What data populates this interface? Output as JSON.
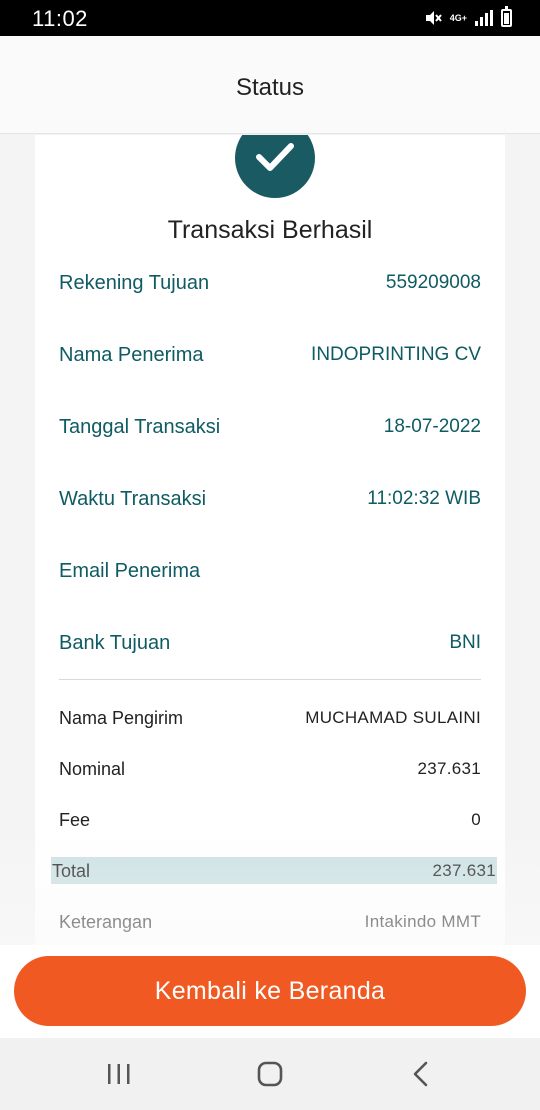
{
  "status_bar": {
    "time": "11:02",
    "network": "4G+",
    "icons": [
      "mute-icon",
      "network-4g-icon",
      "signal-icon",
      "battery-icon"
    ]
  },
  "header": {
    "title": "Status"
  },
  "result": {
    "icon": "check-icon",
    "title": "Transaksi Berhasil"
  },
  "details": [
    {
      "label": "Rekening Tujuan",
      "value": "559209008"
    },
    {
      "label": "Nama Penerima",
      "value": "INDOPRINTING CV"
    },
    {
      "label": "Tanggal Transaksi",
      "value": "18-07-2022"
    },
    {
      "label": "Waktu Transaksi",
      "value": "11:02:32 WIB"
    },
    {
      "label": "Email Penerima",
      "value": ""
    },
    {
      "label": "Bank Tujuan",
      "value": "BNI"
    }
  ],
  "summary": [
    {
      "label": "Nama Pengirim",
      "value": "MUCHAMAD SULAINI"
    },
    {
      "label": "Nominal",
      "value": "237.631"
    },
    {
      "label": "Fee",
      "value": "0"
    },
    {
      "label": "Total",
      "value": "237.631"
    },
    {
      "label": "Keterangan",
      "value": "Intakindo MMT"
    }
  ],
  "cta": {
    "label": "Kembali ke Beranda"
  },
  "nav_bar": {
    "icons": [
      "recent-apps-icon",
      "home-icon",
      "back-icon"
    ]
  },
  "colors": {
    "accent": "#f05a22",
    "primary_text": "#0f5b63",
    "check_circle": "#1a5a63",
    "total_highlight": "#c8dfe2"
  }
}
